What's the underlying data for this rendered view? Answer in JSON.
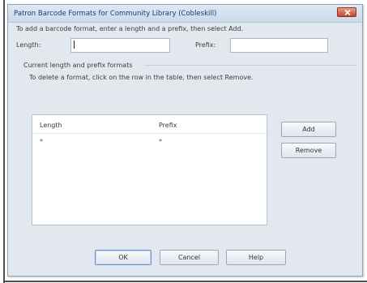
{
  "dialog": {
    "title": "Patron Barcode Formats for Community Library (Cobleskill)",
    "instructions": "To add a barcode format, enter a length and a prefix, then select Add.",
    "length_label": "Length:",
    "length_value": "",
    "prefix_label": "Prefix:",
    "prefix_value": "",
    "group_label": "Current length and prefix formats",
    "delete_instructions": "To delete a format, click on the row in the table, then select Remove.",
    "table": {
      "headers": [
        "Length",
        "Prefix"
      ],
      "rows": [
        [
          "*",
          "*"
        ]
      ]
    },
    "buttons": {
      "add": "Add",
      "remove": "Remove",
      "ok": "OK",
      "cancel": "Cancel",
      "help": "Help"
    }
  },
  "colors": {
    "title_text": "#1e3a73",
    "close_button": "#c2452a",
    "dialog_background": "#e3e8ef"
  },
  "icons": {
    "close": "close-icon"
  }
}
